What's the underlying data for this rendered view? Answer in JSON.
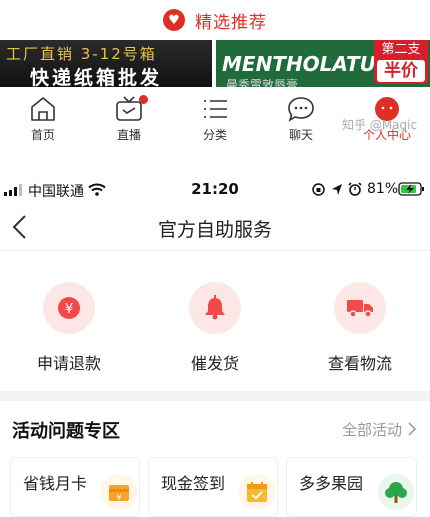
{
  "featured": {
    "label": "精选推荐"
  },
  "banner_left": {
    "line1": "工厂直销   3-12号箱",
    "line2": "快递纸箱批发"
  },
  "banner_right": {
    "brand": "MENTHOLATUM",
    "sub": "曼秀雷敦唇膏",
    "tag_top": "第二支",
    "tag_bottom": "半价"
  },
  "app_nav": [
    {
      "label": "首页",
      "icon": "home-icon"
    },
    {
      "label": "直播",
      "icon": "tv-icon"
    },
    {
      "label": "分类",
      "icon": "list-icon"
    },
    {
      "label": "聊天",
      "icon": "chat-icon"
    },
    {
      "label": "个人中心",
      "icon": "avatar-icon"
    }
  ],
  "watermark": "知乎 @Magic",
  "status_bar": {
    "carrier": "中国联通",
    "time": "21:20",
    "battery": "81%"
  },
  "header": {
    "title": "官方自助服务"
  },
  "services": [
    {
      "label": "申请退款",
      "icon": "refund-icon"
    },
    {
      "label": "催发货",
      "icon": "bell-icon"
    },
    {
      "label": "查看物流",
      "icon": "truck-icon"
    }
  ],
  "section": {
    "title": "活动问题专区",
    "all_label": "全部活动"
  },
  "cards": [
    {
      "label": "省钱月卡",
      "icon": "card-icon"
    },
    {
      "label": "现金签到",
      "icon": "calendar-icon"
    },
    {
      "label": "多多果园",
      "icon": "tree-icon"
    }
  ],
  "colors": {
    "accent": "#e02e24",
    "service_bg": "#fde7e6"
  }
}
